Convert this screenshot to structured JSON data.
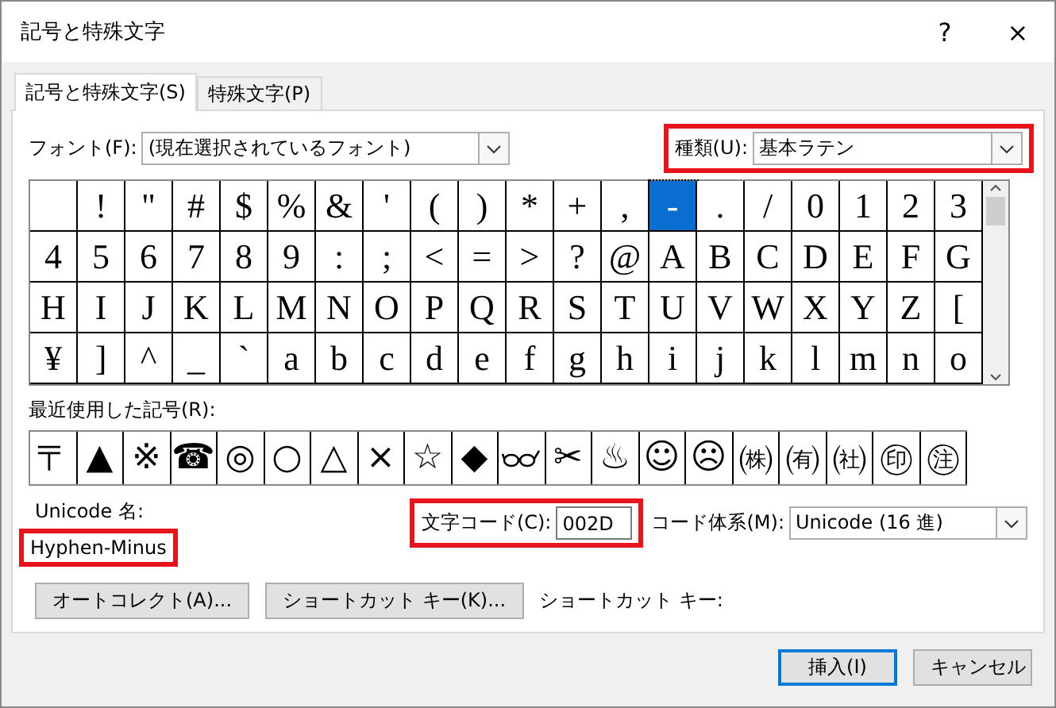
{
  "window": {
    "title": "記号と特殊文字",
    "help": "?",
    "close": "×"
  },
  "tabs": [
    {
      "label": "記号と特殊文字(S)",
      "selected": true
    },
    {
      "label": "特殊文字(P)",
      "selected": false
    }
  ],
  "font": {
    "label": "フォント(F):",
    "value": "(現在選択されているフォント)"
  },
  "subset": {
    "label": "種類(U):",
    "value": "基本ラテン",
    "highlighted": true
  },
  "grid": {
    "rows": [
      [
        {
          "selected": false
        },
        {
          "char": "!",
          "selected": false
        },
        {
          "char": "\"",
          "selected": false
        },
        {
          "char": "#",
          "selected": false
        },
        {
          "char": "$",
          "selected": false
        },
        {
          "char": "%",
          "selected": false
        },
        {
          "char": "&",
          "selected": false
        },
        {
          "char": "'",
          "selected": false
        },
        {
          "char": "(",
          "selected": false
        },
        {
          "char": ")",
          "selected": false
        },
        {
          "char": "*",
          "selected": false
        },
        {
          "char": "+",
          "selected": false
        },
        {
          "char": ",",
          "selected": false
        },
        {
          "char": "-",
          "selected": true
        },
        {
          "char": ".",
          "selected": false
        },
        {
          "char": "/",
          "selected": false
        },
        {
          "char": "0",
          "selected": false
        },
        {
          "char": "1",
          "selected": false
        },
        {
          "char": "2",
          "selected": false
        },
        {
          "char": "3",
          "selected": false
        }
      ],
      [
        {
          "char": "4",
          "selected": false
        },
        {
          "char": "5",
          "selected": false
        },
        {
          "char": "6",
          "selected": false
        },
        {
          "char": "7",
          "selected": false
        },
        {
          "char": "8",
          "selected": false
        },
        {
          "char": "9",
          "selected": false
        },
        {
          "char": ":",
          "selected": false
        },
        {
          "char": ";",
          "selected": false
        },
        {
          "char": "<",
          "selected": false
        },
        {
          "char": "=",
          "selected": false
        },
        {
          "char": ">",
          "selected": false
        },
        {
          "char": "?",
          "selected": false
        },
        {
          "char": "@",
          "selected": false
        },
        {
          "char": "A",
          "selected": false
        },
        {
          "char": "B",
          "selected": false
        },
        {
          "char": "C",
          "selected": false
        },
        {
          "char": "D",
          "selected": false
        },
        {
          "char": "E",
          "selected": false
        },
        {
          "char": "F",
          "selected": false
        },
        {
          "char": "G",
          "selected": false
        }
      ],
      [
        {
          "char": "H",
          "selected": false
        },
        {
          "char": "I",
          "selected": false
        },
        {
          "char": "J",
          "selected": false
        },
        {
          "char": "K",
          "selected": false
        },
        {
          "char": "L",
          "selected": false
        },
        {
          "char": "M",
          "selected": false
        },
        {
          "char": "N",
          "selected": false
        },
        {
          "char": "O",
          "selected": false
        },
        {
          "char": "P",
          "selected": false
        },
        {
          "char": "Q",
          "selected": false
        },
        {
          "char": "R",
          "selected": false
        },
        {
          "char": "S",
          "selected": false
        },
        {
          "char": "T",
          "selected": false
        },
        {
          "char": "U",
          "selected": false
        },
        {
          "char": "V",
          "selected": false
        },
        {
          "char": "W",
          "selected": false
        },
        {
          "char": "X",
          "selected": false
        },
        {
          "char": "Y",
          "selected": false
        },
        {
          "char": "Z",
          "selected": false
        },
        {
          "char": "[",
          "selected": false
        }
      ],
      [
        {
          "char": "¥",
          "selected": false
        },
        {
          "char": "]",
          "selected": false
        },
        {
          "char": "^",
          "selected": false
        },
        {
          "char": "_",
          "selected": false
        },
        {
          "char": "`",
          "selected": false
        },
        {
          "char": "a",
          "selected": false
        },
        {
          "char": "b",
          "selected": false
        },
        {
          "char": "c",
          "selected": false
        },
        {
          "char": "d",
          "selected": false
        },
        {
          "char": "e",
          "selected": false
        },
        {
          "char": "f",
          "selected": false
        },
        {
          "char": "g",
          "selected": false
        },
        {
          "char": "h",
          "selected": false
        },
        {
          "char": "i",
          "selected": false
        },
        {
          "char": "j",
          "selected": false
        },
        {
          "char": "k",
          "selected": false
        },
        {
          "char": "l",
          "selected": false
        },
        {
          "char": "m",
          "selected": false
        },
        {
          "char": "n",
          "selected": false
        },
        {
          "char": "o",
          "selected": false
        }
      ]
    ]
  },
  "recent": {
    "label": "最近使用した記号(R):",
    "items": [
      {
        "kind": "char",
        "char": "〒"
      },
      {
        "kind": "char",
        "char": "▲"
      },
      {
        "kind": "char",
        "char": "※"
      },
      {
        "kind": "char",
        "char": "☎"
      },
      {
        "kind": "char",
        "char": "◎"
      },
      {
        "kind": "char",
        "char": "○"
      },
      {
        "kind": "char",
        "char": "△"
      },
      {
        "kind": "char",
        "char": "×"
      },
      {
        "kind": "char",
        "char": "☆"
      },
      {
        "kind": "char",
        "char": "◆"
      },
      {
        "kind": "glasses"
      },
      {
        "kind": "char",
        "char": "✂"
      },
      {
        "kind": "char",
        "char": "♨"
      },
      {
        "kind": "char",
        "char": "☺"
      },
      {
        "kind": "char",
        "char": "☹"
      },
      {
        "kind": "char",
        "char": "㈱"
      },
      {
        "kind": "char",
        "char": "㈲"
      },
      {
        "kind": "char",
        "char": "㈳"
      },
      {
        "kind": "char",
        "char": "㊞"
      },
      {
        "kind": "char",
        "char": "㊟"
      }
    ]
  },
  "unicode_name": {
    "label": "Unicode 名:",
    "value": "Hyphen-Minus",
    "highlighted": true
  },
  "char_code": {
    "label": "文字コード(C):",
    "value": "002D",
    "highlighted": true
  },
  "code_system": {
    "label": "コード体系(M):",
    "value": "Unicode (16 進)"
  },
  "buttons": [
    {
      "label": "オートコレクト(A)..."
    },
    {
      "label": "ショートカット キー(K)..."
    }
  ],
  "shortcut_label": "ショートカット キー:",
  "footer_buttons": [
    {
      "label": "挿入(I)",
      "default": true
    },
    {
      "label": "キャンセル",
      "default": false
    }
  ]
}
